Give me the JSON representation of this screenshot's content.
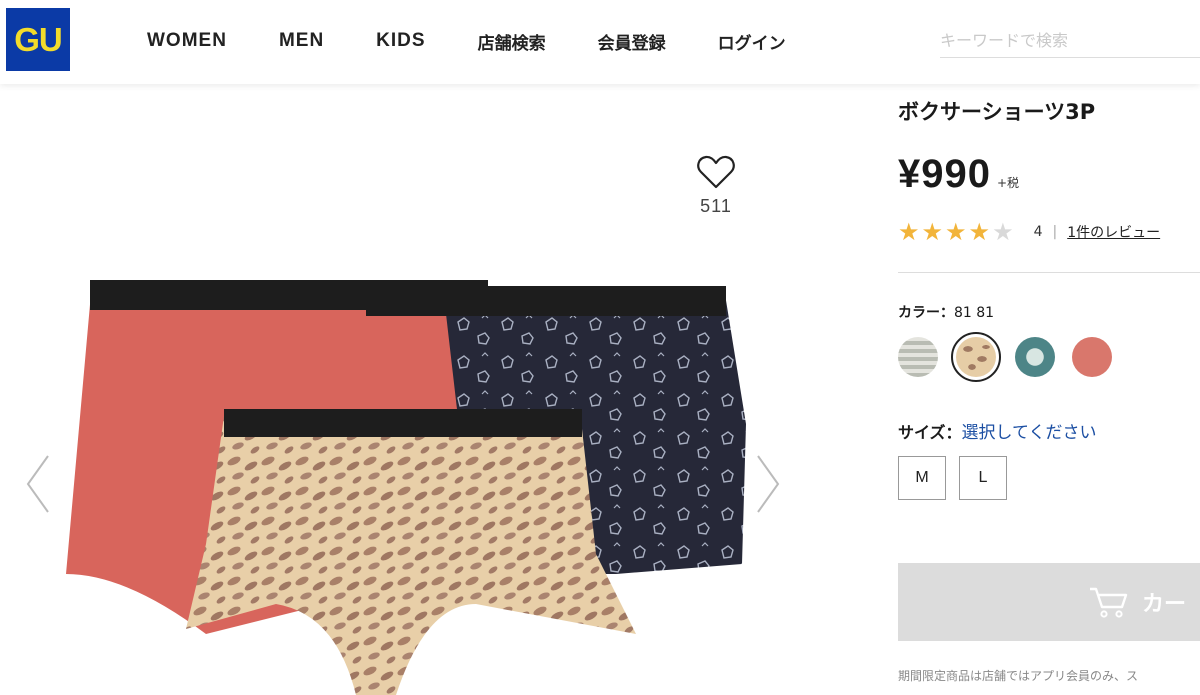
{
  "header": {
    "logo": "GU",
    "nav": [
      "WOMEN",
      "MEN",
      "KIDS",
      "店舗検索",
      "会員登録",
      "ログイン"
    ],
    "search_placeholder": "キーワードで検索"
  },
  "gallery": {
    "favorite_count": "511"
  },
  "product": {
    "title": "ボクサーショーツ3P",
    "price": "¥990",
    "tax": "+税",
    "rating_value": 4,
    "rating_text": "4",
    "review_link": "1件のレビュー",
    "color_label": "カラー：",
    "color_value": "81 81",
    "colors": [
      "stripe",
      "leopard",
      "teal-pattern",
      "coral"
    ],
    "size_label": "サイズ：",
    "size_prompt": "選択してください",
    "sizes": [
      "M",
      "L"
    ],
    "cart_label": "カー",
    "note": "期間限定商品は店舗ではアプリ会員のみ、ス"
  },
  "colors": {
    "logo_bg": "#0b3aa6",
    "logo_fg": "#f3dc2b",
    "star": "#f2b43a",
    "link_blue": "#1c4fa3"
  }
}
